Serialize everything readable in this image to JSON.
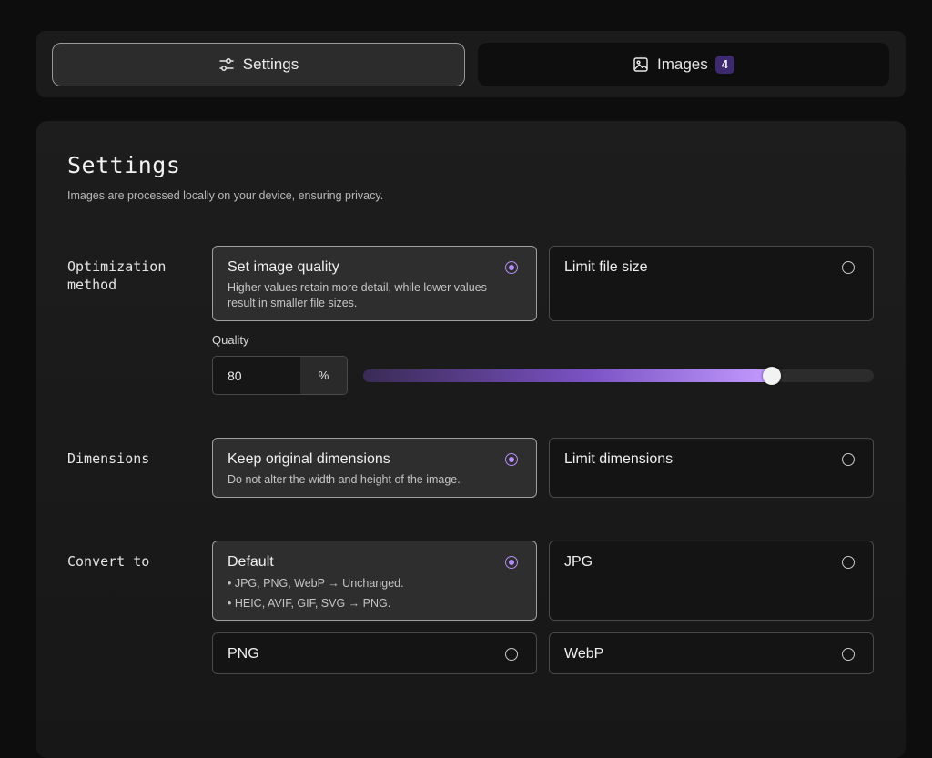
{
  "tabs": {
    "settings": {
      "label": "Settings",
      "icon": "sliders-icon",
      "active": true
    },
    "images": {
      "label": "Images",
      "icon": "image-icon",
      "count": "4"
    }
  },
  "header": {
    "title": "Settings",
    "subtitle": "Images are processed locally on your device, ensuring privacy."
  },
  "optimization": {
    "label": "Optimization method",
    "options": [
      {
        "title": "Set image quality",
        "description": "Higher values retain more detail, while lower values result in smaller file sizes.",
        "selected": true
      },
      {
        "title": "Limit file size",
        "selected": false
      }
    ],
    "quality": {
      "label": "Quality",
      "value": "80",
      "unit": "%",
      "slider_fraction": 0.8
    }
  },
  "dimensions": {
    "label": "Dimensions",
    "options": [
      {
        "title": "Keep original dimensions",
        "description": "Do not alter the width and height of the image.",
        "selected": true
      },
      {
        "title": "Limit dimensions",
        "selected": false
      }
    ]
  },
  "convert": {
    "label": "Convert to",
    "options": [
      {
        "title": "Default",
        "lines": [
          "• JPG, PNG, WebP → Unchanged.",
          "• HEIC, AVIF, GIF, SVG → PNG."
        ],
        "selected": true
      },
      {
        "title": "JPG",
        "selected": false
      },
      {
        "title": "PNG",
        "selected": false
      },
      {
        "title": "WebP",
        "selected": false
      }
    ]
  },
  "colors": {
    "accent": "#b48cf5",
    "badge_bg": "#3d2a6e",
    "background": "#0d0d0d",
    "panel": "#1b1b1b"
  }
}
